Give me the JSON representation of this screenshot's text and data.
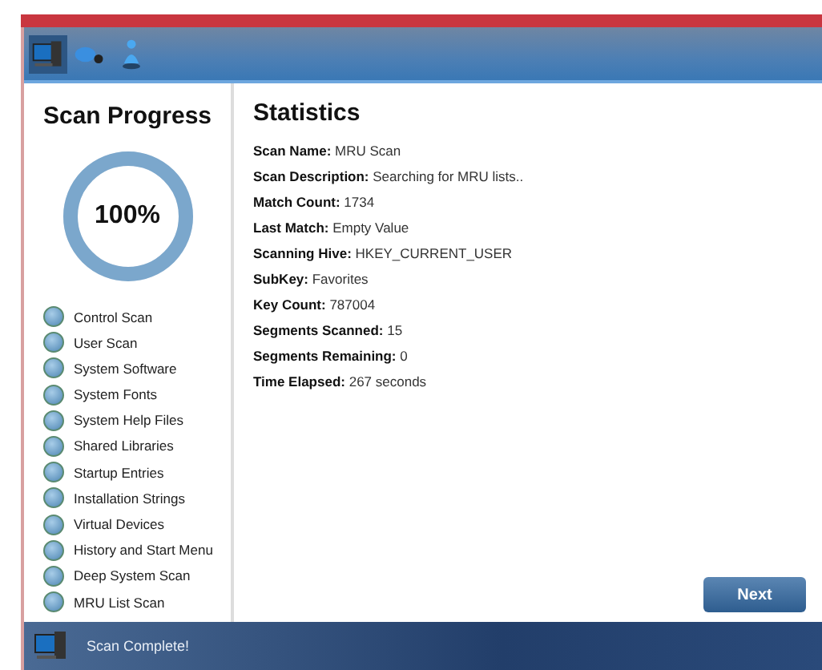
{
  "toolbar": [
    {
      "kind": "computer",
      "selected": true
    },
    {
      "kind": "mouse",
      "selected": false
    },
    {
      "kind": "person",
      "selected": false
    }
  ],
  "progress": {
    "title": "Scan Progress",
    "level": 1,
    "reading": "100%"
  },
  "steps": [
    "Control Scan",
    "User Scan",
    "System Software",
    "System Fonts",
    "System Help Files",
    "Shared Libraries",
    "Startup Entries",
    "Installation Strings",
    "Virtual Devices",
    "History and Start Menu",
    "Deep System Scan",
    "MRU List Scan"
  ],
  "statistics": {
    "title": "Statistics",
    "lines": [
      "**Scan Name:** MRU Scan",
      "**Scan Description:** Searching for MRU lists..",
      "**Match Count:** 1734",
      "**Last Match:** Empty Value",
      "**Scanning Hive:** HKEY_CURRENT_USER",
      "**SubKey:** Favorites",
      "**Key Count:** 787004",
      "**Segments Scanned:** 15",
      "**Segments Remaining:** 0",
      "**Time Elapsed:** 267 seconds"
    ]
  },
  "next_button": "Next",
  "status_bar": "Scan Complete!"
}
